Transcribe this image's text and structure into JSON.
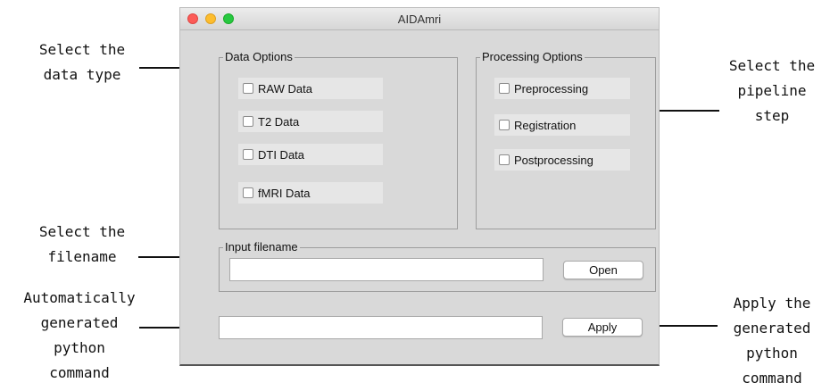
{
  "window": {
    "title": "AIDAmri"
  },
  "data_options": {
    "label": "Data Options",
    "items": [
      {
        "label": "RAW Data",
        "checked": false
      },
      {
        "label": "T2 Data",
        "checked": false
      },
      {
        "label": "DTI Data",
        "checked": false
      },
      {
        "label": "fMRI Data",
        "checked": false
      }
    ]
  },
  "processing_options": {
    "label": "Processing Options",
    "items": [
      {
        "label": "Preprocessing",
        "checked": false
      },
      {
        "label": "Registration",
        "checked": false
      },
      {
        "label": "Postprocessing",
        "checked": false
      }
    ]
  },
  "input_filename": {
    "label": "Input filename",
    "value": "",
    "open_label": "Open"
  },
  "command": {
    "value": "",
    "apply_label": "Apply"
  },
  "annotations": {
    "data_type": "Select the\ndata type",
    "pipeline": "Select the\npipeline\nstep",
    "filename": "Select the\nfilename",
    "generated": "Automatically\ngenerated\npython\ncommand",
    "apply": "Apply the\ngenerated\npython\ncommand"
  }
}
